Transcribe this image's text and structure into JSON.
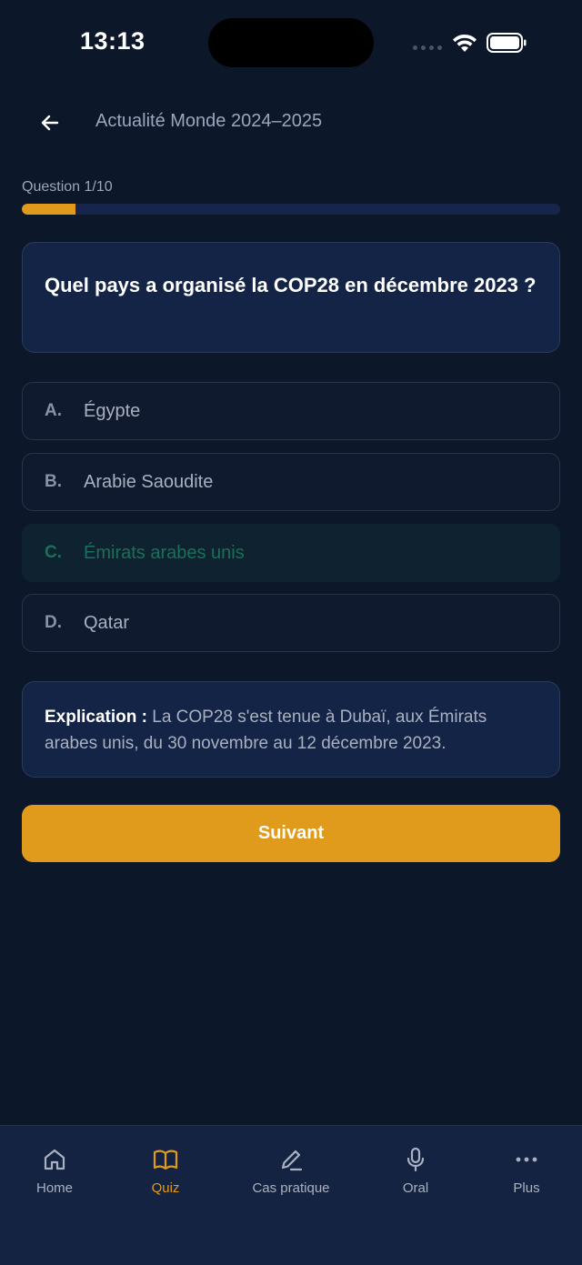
{
  "status": {
    "time": "13:13"
  },
  "header": {
    "title": "Actualité Monde 2024–2025"
  },
  "progress": {
    "label": "Question 1/10",
    "fraction": 0.1
  },
  "question": {
    "text": "Quel pays a organisé la COP28 en décembre 2023 ?"
  },
  "options": [
    {
      "letter": "A.",
      "text": "Égypte",
      "state": "default"
    },
    {
      "letter": "B.",
      "text": "Arabie Saoudite",
      "state": "default"
    },
    {
      "letter": "C.",
      "text": "Émirats arabes unis",
      "state": "correct"
    },
    {
      "letter": "D.",
      "text": "Qatar",
      "state": "default"
    }
  ],
  "explanation": {
    "lead": "Explication :",
    "text": "La COP28 s'est tenue à Dubaï, aux Émirats arabes unis, du 30 novembre au 12 décembre 2023."
  },
  "next_button": {
    "label": "Suivant"
  },
  "nav": {
    "active": "quiz",
    "items": [
      {
        "id": "home",
        "label": "Home",
        "icon": "home-icon"
      },
      {
        "id": "quiz",
        "label": "Quiz",
        "icon": "book-icon"
      },
      {
        "id": "cas",
        "label": "Cas pratique",
        "icon": "pencil-icon"
      },
      {
        "id": "oral",
        "label": "Oral",
        "icon": "microphone-icon"
      },
      {
        "id": "plus",
        "label": "Plus",
        "icon": "more-icon"
      }
    ]
  },
  "colors": {
    "background": "#0c1729",
    "accent": "#e09a1c",
    "card": "#142446",
    "correct_text": "#1c6f5c",
    "nav_inactive": "#a9b1c0"
  }
}
